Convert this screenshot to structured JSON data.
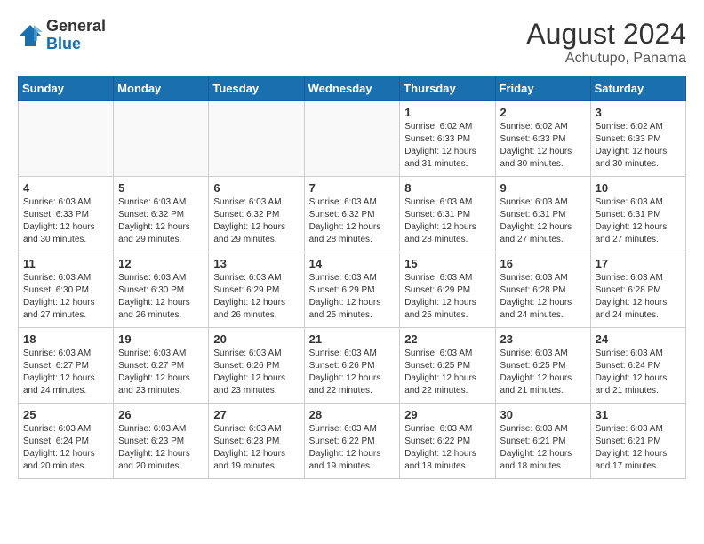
{
  "header": {
    "logo_general": "General",
    "logo_blue": "Blue",
    "month_year": "August 2024",
    "location": "Achutupo, Panama"
  },
  "days_of_week": [
    "Sunday",
    "Monday",
    "Tuesday",
    "Wednesday",
    "Thursday",
    "Friday",
    "Saturday"
  ],
  "weeks": [
    [
      {
        "day": "",
        "info": ""
      },
      {
        "day": "",
        "info": ""
      },
      {
        "day": "",
        "info": ""
      },
      {
        "day": "",
        "info": ""
      },
      {
        "day": "1",
        "info": "Sunrise: 6:02 AM\nSunset: 6:33 PM\nDaylight: 12 hours\nand 31 minutes."
      },
      {
        "day": "2",
        "info": "Sunrise: 6:02 AM\nSunset: 6:33 PM\nDaylight: 12 hours\nand 30 minutes."
      },
      {
        "day": "3",
        "info": "Sunrise: 6:02 AM\nSunset: 6:33 PM\nDaylight: 12 hours\nand 30 minutes."
      }
    ],
    [
      {
        "day": "4",
        "info": "Sunrise: 6:03 AM\nSunset: 6:33 PM\nDaylight: 12 hours\nand 30 minutes."
      },
      {
        "day": "5",
        "info": "Sunrise: 6:03 AM\nSunset: 6:32 PM\nDaylight: 12 hours\nand 29 minutes."
      },
      {
        "day": "6",
        "info": "Sunrise: 6:03 AM\nSunset: 6:32 PM\nDaylight: 12 hours\nand 29 minutes."
      },
      {
        "day": "7",
        "info": "Sunrise: 6:03 AM\nSunset: 6:32 PM\nDaylight: 12 hours\nand 28 minutes."
      },
      {
        "day": "8",
        "info": "Sunrise: 6:03 AM\nSunset: 6:31 PM\nDaylight: 12 hours\nand 28 minutes."
      },
      {
        "day": "9",
        "info": "Sunrise: 6:03 AM\nSunset: 6:31 PM\nDaylight: 12 hours\nand 27 minutes."
      },
      {
        "day": "10",
        "info": "Sunrise: 6:03 AM\nSunset: 6:31 PM\nDaylight: 12 hours\nand 27 minutes."
      }
    ],
    [
      {
        "day": "11",
        "info": "Sunrise: 6:03 AM\nSunset: 6:30 PM\nDaylight: 12 hours\nand 27 minutes."
      },
      {
        "day": "12",
        "info": "Sunrise: 6:03 AM\nSunset: 6:30 PM\nDaylight: 12 hours\nand 26 minutes."
      },
      {
        "day": "13",
        "info": "Sunrise: 6:03 AM\nSunset: 6:29 PM\nDaylight: 12 hours\nand 26 minutes."
      },
      {
        "day": "14",
        "info": "Sunrise: 6:03 AM\nSunset: 6:29 PM\nDaylight: 12 hours\nand 25 minutes."
      },
      {
        "day": "15",
        "info": "Sunrise: 6:03 AM\nSunset: 6:29 PM\nDaylight: 12 hours\nand 25 minutes."
      },
      {
        "day": "16",
        "info": "Sunrise: 6:03 AM\nSunset: 6:28 PM\nDaylight: 12 hours\nand 24 minutes."
      },
      {
        "day": "17",
        "info": "Sunrise: 6:03 AM\nSunset: 6:28 PM\nDaylight: 12 hours\nand 24 minutes."
      }
    ],
    [
      {
        "day": "18",
        "info": "Sunrise: 6:03 AM\nSunset: 6:27 PM\nDaylight: 12 hours\nand 24 minutes."
      },
      {
        "day": "19",
        "info": "Sunrise: 6:03 AM\nSunset: 6:27 PM\nDaylight: 12 hours\nand 23 minutes."
      },
      {
        "day": "20",
        "info": "Sunrise: 6:03 AM\nSunset: 6:26 PM\nDaylight: 12 hours\nand 23 minutes."
      },
      {
        "day": "21",
        "info": "Sunrise: 6:03 AM\nSunset: 6:26 PM\nDaylight: 12 hours\nand 22 minutes."
      },
      {
        "day": "22",
        "info": "Sunrise: 6:03 AM\nSunset: 6:25 PM\nDaylight: 12 hours\nand 22 minutes."
      },
      {
        "day": "23",
        "info": "Sunrise: 6:03 AM\nSunset: 6:25 PM\nDaylight: 12 hours\nand 21 minutes."
      },
      {
        "day": "24",
        "info": "Sunrise: 6:03 AM\nSunset: 6:24 PM\nDaylight: 12 hours\nand 21 minutes."
      }
    ],
    [
      {
        "day": "25",
        "info": "Sunrise: 6:03 AM\nSunset: 6:24 PM\nDaylight: 12 hours\nand 20 minutes."
      },
      {
        "day": "26",
        "info": "Sunrise: 6:03 AM\nSunset: 6:23 PM\nDaylight: 12 hours\nand 20 minutes."
      },
      {
        "day": "27",
        "info": "Sunrise: 6:03 AM\nSunset: 6:23 PM\nDaylight: 12 hours\nand 19 minutes."
      },
      {
        "day": "28",
        "info": "Sunrise: 6:03 AM\nSunset: 6:22 PM\nDaylight: 12 hours\nand 19 minutes."
      },
      {
        "day": "29",
        "info": "Sunrise: 6:03 AM\nSunset: 6:22 PM\nDaylight: 12 hours\nand 18 minutes."
      },
      {
        "day": "30",
        "info": "Sunrise: 6:03 AM\nSunset: 6:21 PM\nDaylight: 12 hours\nand 18 minutes."
      },
      {
        "day": "31",
        "info": "Sunrise: 6:03 AM\nSunset: 6:21 PM\nDaylight: 12 hours\nand 17 minutes."
      }
    ]
  ]
}
